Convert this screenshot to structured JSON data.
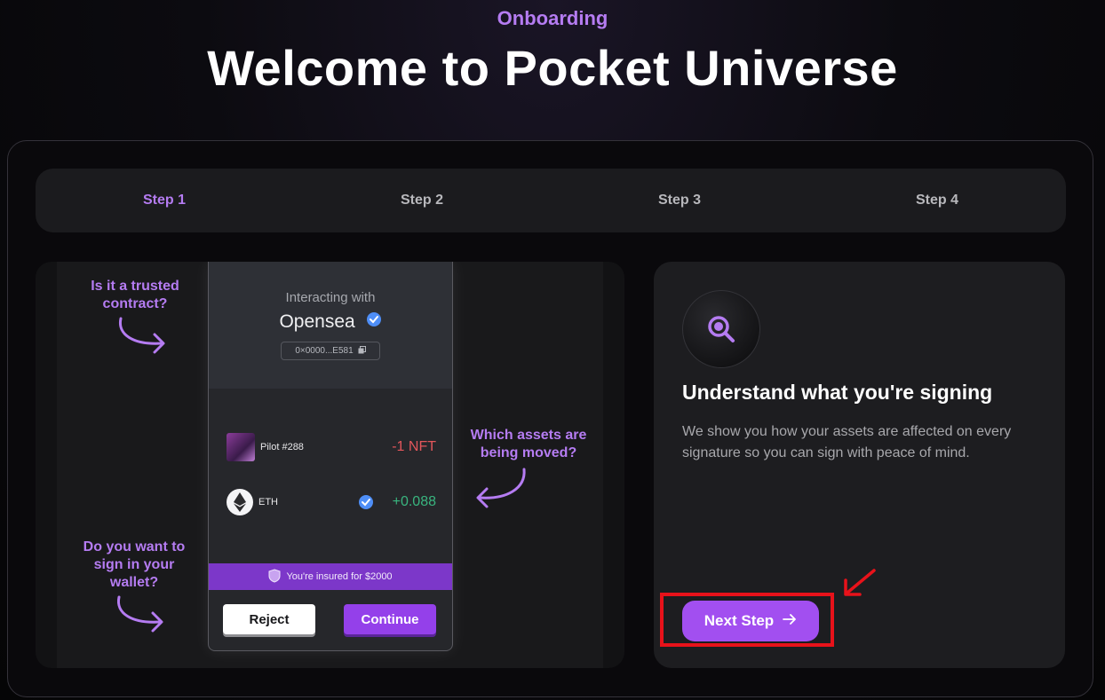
{
  "header": {
    "eyebrow": "Onboarding",
    "title": "Welcome to Pocket Universe"
  },
  "steps": [
    {
      "label": "Step 1",
      "active": true
    },
    {
      "label": "Step 2",
      "active": false
    },
    {
      "label": "Step 3",
      "active": false
    },
    {
      "label": "Step 4",
      "active": false
    }
  ],
  "illustration": {
    "annotations": {
      "trusted": "Is it a trusted contract?",
      "assets": "Which assets are being moved?",
      "sign": "Do you want to sign in your wallet?"
    },
    "wallet": {
      "interacting_label": "Interacting with",
      "destination": "Opensea",
      "address": "0×0000...E581",
      "assets": [
        {
          "name": "Pilot #288",
          "amount": "-1 NFT",
          "icon": "nft-thumbnail"
        },
        {
          "name": "ETH",
          "amount": "+0.088",
          "icon": "eth-icon",
          "verified": true
        }
      ],
      "insured_text": "You're insured for $2000",
      "reject_label": "Reject",
      "continue_label": "Continue"
    }
  },
  "info": {
    "icon": "magnifier-icon",
    "title": "Understand what you're signing",
    "description": "We show you how your assets are affected on every signature so you can sign with peace of mind.",
    "next_label": "Next Step"
  },
  "colors": {
    "accent": "#b57cf2",
    "button": "#a24ff0",
    "highlight": "#e8121a",
    "negative": "#e3565b",
    "positive": "#39b57f"
  }
}
